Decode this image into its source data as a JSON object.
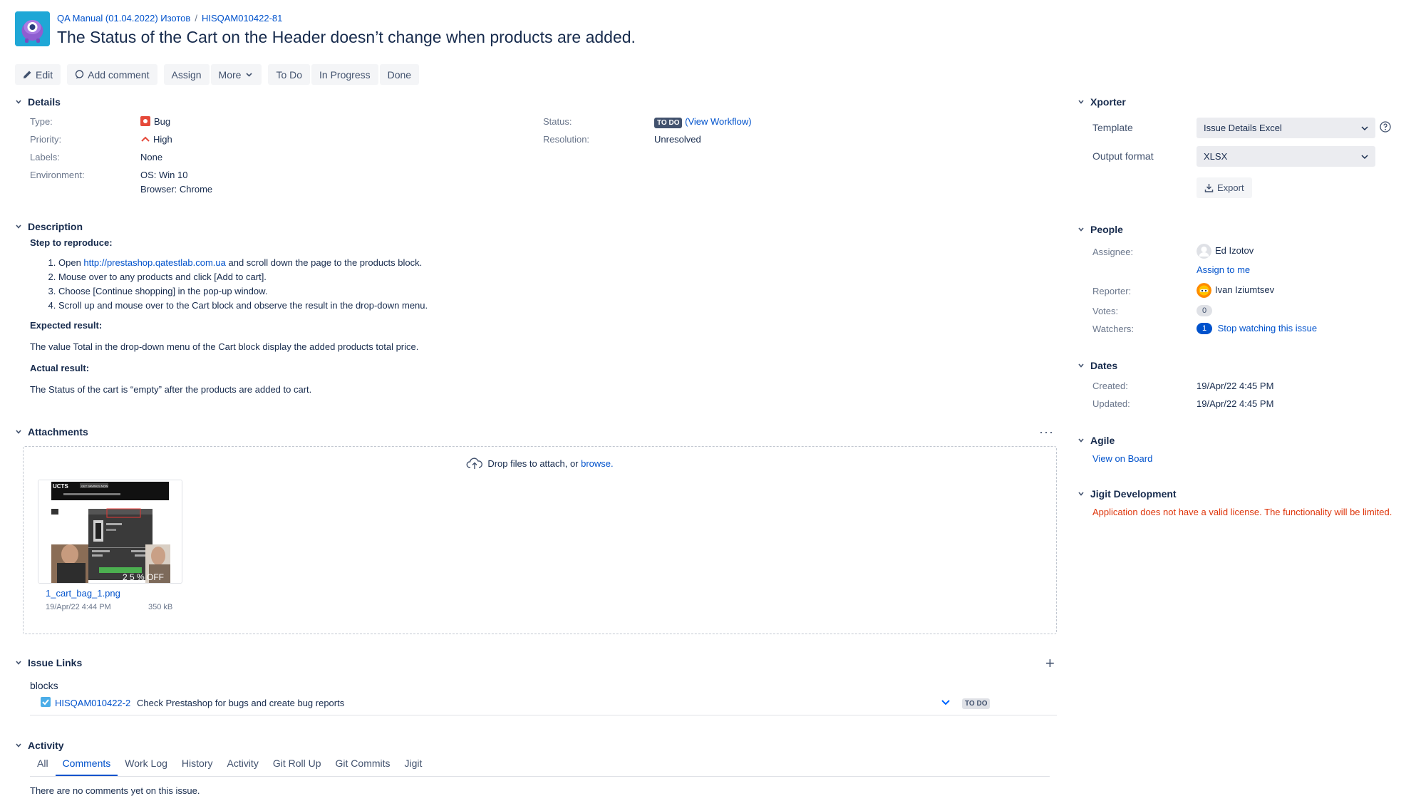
{
  "header": {
    "project_link": "QA Manual (01.04.2022) Изотов",
    "separator": "/",
    "issue_key": "HISQAM010422-81",
    "title": "The Status of the Cart on the Header doesn’t change when products are added."
  },
  "toolbar": {
    "edit": "Edit",
    "add_comment": "Add comment",
    "assign": "Assign",
    "more": "More",
    "to_do": "To Do",
    "in_progress": "In Progress",
    "done": "Done"
  },
  "details": {
    "heading": "Details",
    "type_label": "Type:",
    "type_value": "Bug",
    "priority_label": "Priority:",
    "priority_value": "High",
    "labels_label": "Labels:",
    "labels_value": "None",
    "environment_label": "Environment:",
    "environment_os": "OS: Win 10",
    "environment_browser": "Browser: Chrome",
    "status_label": "Status:",
    "status_value": "TO DO",
    "view_workflow": "(View Workflow)",
    "resolution_label": "Resolution:",
    "resolution_value": "Unresolved"
  },
  "description": {
    "heading": "Description",
    "steps_heading": "Step to reproduce:",
    "step1_prefix": "Open ",
    "step1_link": "http://prestashop.qatestlab.com.ua",
    "step1_suffix": " and scroll down the page to the products block.",
    "step2": "Mouse over to any products and click [Add to cart].",
    "step3": "Choose [Continue shopping] in the pop-up window.",
    "step4": "Scroll up and mouse over to the Cart block and observe the result in the drop-down menu.",
    "expected_heading": "Expected result:",
    "expected_text": "The value Total in the drop-down menu of the Cart block display the added products total price.",
    "actual_heading": "Actual result:",
    "actual_text": "The Status of the cart is “empty” after the products are added to cart."
  },
  "attachments": {
    "heading": "Attachments",
    "drop_text": "Drop files to attach, or ",
    "browse": "browse.",
    "file_name": "1_cart_bag_1.png",
    "file_date": "19/Apr/22 4:44 PM",
    "file_size": "350 kB"
  },
  "issue_links": {
    "heading": "Issue Links",
    "relation": "blocks",
    "link_key": "HISQAM010422-2",
    "link_summary": "Check Prestashop for bugs and create bug reports",
    "link_status": "TO DO"
  },
  "activity": {
    "heading": "Activity",
    "tabs": [
      "All",
      "Comments",
      "Work Log",
      "History",
      "Activity",
      "Git Roll Up",
      "Git Commits",
      "Jigit"
    ],
    "empty_text": "There are no comments yet on this issue."
  },
  "xporter": {
    "heading": "Xporter",
    "template_label": "Template",
    "template_value": "Issue Details Excel",
    "format_label": "Output format",
    "format_value": "XLSX",
    "export": "Export"
  },
  "people": {
    "heading": "People",
    "assignee_label": "Assignee:",
    "assignee_name": "Ed Izotov",
    "assign_to_me": "Assign to me",
    "reporter_label": "Reporter:",
    "reporter_name": "Ivan Iziumtsev",
    "votes_label": "Votes:",
    "votes_count": "0",
    "watchers_label": "Watchers:",
    "watchers_count": "1",
    "stop_watching": "Stop watching this issue"
  },
  "dates": {
    "heading": "Dates",
    "created_label": "Created:",
    "created_value": "19/Apr/22 4:45 PM",
    "updated_label": "Updated:",
    "updated_value": "19/Apr/22 4:45 PM"
  },
  "agile": {
    "heading": "Agile",
    "view_on_board": "View on Board"
  },
  "jigit": {
    "heading": "Jigit Development",
    "license_warning": "Application does not have a valid license. The functionality will be limited."
  },
  "thumbnail": {
    "logo_text": "UCTS",
    "badge_text": "GET SAVINGS NOW",
    "promo_text": "2 5 % OFF"
  },
  "colors": {
    "link": "#0052cc",
    "text": "#172b4d",
    "muted": "#6b778c",
    "error": "#de350b",
    "bug": "#e5493a"
  }
}
